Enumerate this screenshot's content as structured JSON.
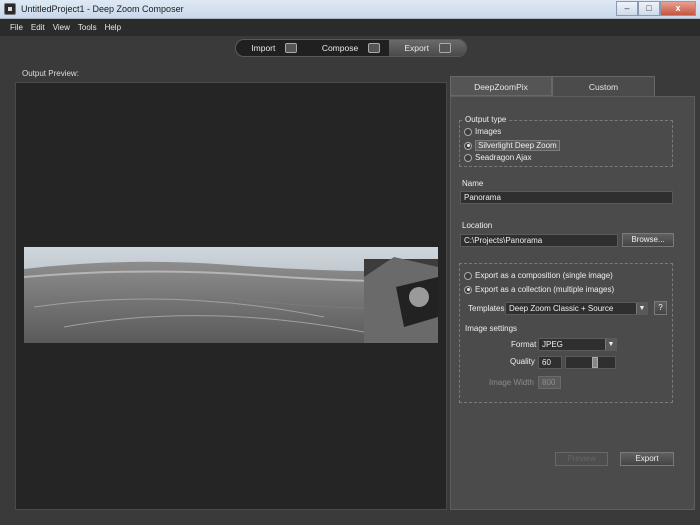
{
  "window": {
    "title": "UntitledProject1 - Deep Zoom Composer",
    "minimize": "–",
    "maximize": "□",
    "close": "x"
  },
  "menu": [
    "File",
    "Edit",
    "View",
    "Tools",
    "Help"
  ],
  "workflow": {
    "tabs": [
      {
        "label": "Import",
        "icon": "import-icon"
      },
      {
        "label": "Compose",
        "icon": "compose-icon"
      },
      {
        "label": "Export",
        "icon": "export-icon",
        "active": true
      }
    ]
  },
  "preview": {
    "label": "Output Preview:"
  },
  "panel": {
    "tabs": [
      {
        "label": "DeepZoomPix"
      },
      {
        "label": "Custom",
        "active": true
      }
    ],
    "output_type": {
      "title": "Output type",
      "options": [
        "Images",
        "Silverlight Deep Zoom",
        "Seadragon Ajax"
      ],
      "selected": "Silverlight Deep Zoom"
    },
    "name": {
      "label": "Name",
      "value": "Panorama"
    },
    "location": {
      "label": "Location",
      "value": "C:\\Projects\\Panorama",
      "browse": "Browse..."
    },
    "export_mode": {
      "options": [
        "Export as a composition (single image)",
        "Export as a collection (multiple images)"
      ],
      "selected": "Export as a collection (multiple images)"
    },
    "templates": {
      "label": "Templates",
      "value": "Deep Zoom Classic + Source",
      "help": "?"
    },
    "image_settings": {
      "title": "Image settings",
      "format_label": "Format",
      "format_value": "JPEG",
      "quality_label": "Quality",
      "quality_value": "60",
      "quality_level": 0.6,
      "width_label": "Image Width",
      "width_value": "800"
    },
    "preview_button": "Preview",
    "export_button": "Export"
  }
}
